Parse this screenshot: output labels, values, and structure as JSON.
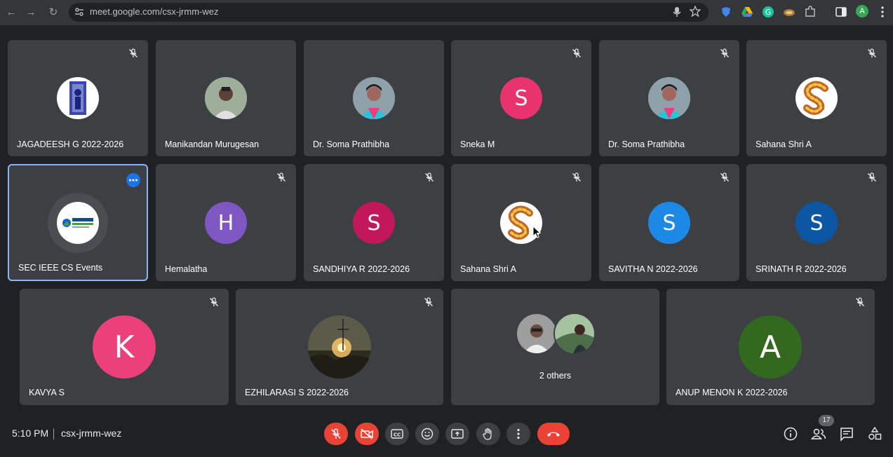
{
  "browser": {
    "url": "meet.google.com/csx-jrmm-wez",
    "profile_initial": "A"
  },
  "tiles_row1": [
    {
      "name": "JAGADEESH G 2022-2026",
      "avatar": "photo",
      "muted": true
    },
    {
      "name": "Manikandan Murugesan",
      "avatar": "photo",
      "muted": false
    },
    {
      "name": "Dr. Soma Prathibha",
      "avatar": "photo",
      "muted": false
    },
    {
      "name": "Sneka M",
      "avatar_letter": "S",
      "avatar_color": "#e8336d",
      "muted": true
    },
    {
      "name": "Dr. Soma Prathibha",
      "avatar": "photo",
      "muted": true
    },
    {
      "name": "Sahana Shri A",
      "avatar": "flower-s",
      "muted": true
    }
  ],
  "tiles_row2": [
    {
      "name": "SEC IEEE CS Events",
      "avatar": "logo",
      "active": true
    },
    {
      "name": "Hemalatha",
      "avatar_letter": "H",
      "avatar_color": "#7e57c2",
      "muted": true
    },
    {
      "name": "SANDHIYA R 2022-2026",
      "avatar_letter": "S",
      "avatar_color": "#c2185b",
      "muted": true
    },
    {
      "name": "Sahana Shri A",
      "avatar": "flower-s",
      "muted": true
    },
    {
      "name": "SAVITHA N 2022-2026",
      "avatar_letter": "S",
      "avatar_color": "#1e88e5",
      "muted": true
    },
    {
      "name": "SRINATH R 2022-2026",
      "avatar_letter": "S",
      "avatar_color": "#0b57a4",
      "muted": true
    }
  ],
  "tiles_row3": [
    {
      "name": "KAVYA S",
      "avatar_letter": "K",
      "avatar_color": "#ec407a",
      "muted": true
    },
    {
      "name": "EZHILARASI S 2022-2026",
      "avatar": "photo",
      "muted": true
    },
    {
      "name": "",
      "others_label": "2 others"
    },
    {
      "name": "ANUP MENON K 2022-2026",
      "avatar_letter": "A",
      "avatar_color": "#33691e",
      "muted": true
    }
  ],
  "bottom_bar": {
    "time": "5:10 PM",
    "meeting_code": "csx-jrmm-wez",
    "participant_count": "17",
    "colors": {
      "danger": "#ea4335",
      "button": "#3c4043"
    }
  }
}
